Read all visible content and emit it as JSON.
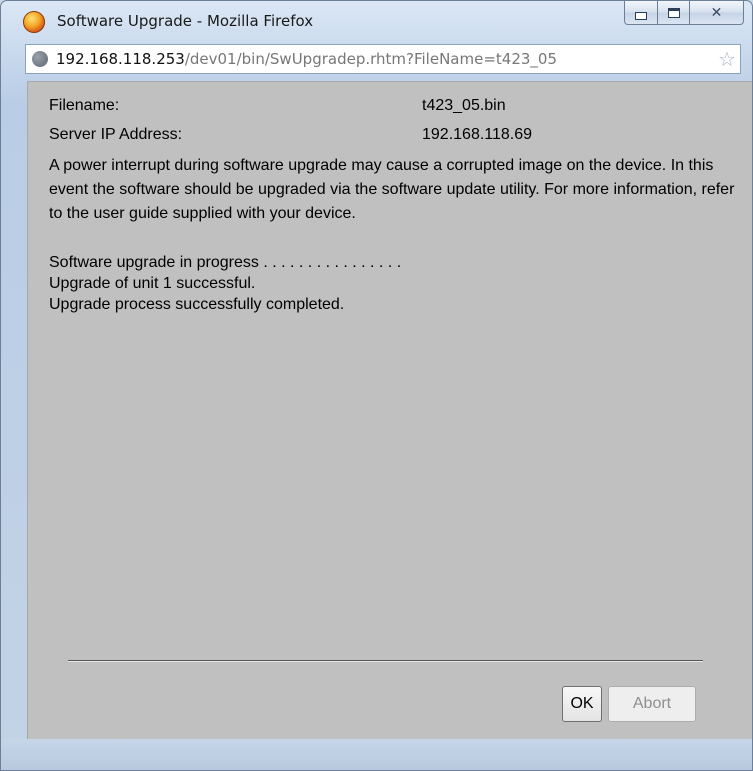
{
  "window": {
    "title": "Software Upgrade - Mozilla Firefox",
    "close_symbol": "✕"
  },
  "urlbar": {
    "host": "192.168.118.253",
    "path": "/dev01/bin/SwUpgradep.rhtm?FileName=t423_05",
    "star_symbol": "☆"
  },
  "details": {
    "filename_label": "Filename:",
    "filename_value": "t423_05.bin",
    "server_ip_label": "Server IP Address:",
    "server_ip_value": "192.168.118.69"
  },
  "warning_text": "A power interrupt during software upgrade may cause a corrupted image on the device. In this event the software should be upgraded via the software update utility. For more information, refer to the user guide supplied with your device.",
  "status_lines": [
    "Software upgrade in progress . . . . . . . . . . . . . . . .",
    "Upgrade of unit 1 successful.",
    "Upgrade process successfully completed."
  ],
  "buttons": {
    "ok_label": "OK",
    "abort_label": "Abort"
  },
  "icons": {
    "app": "firefox-icon",
    "site": "globe-icon",
    "bookmark": "star-icon"
  }
}
